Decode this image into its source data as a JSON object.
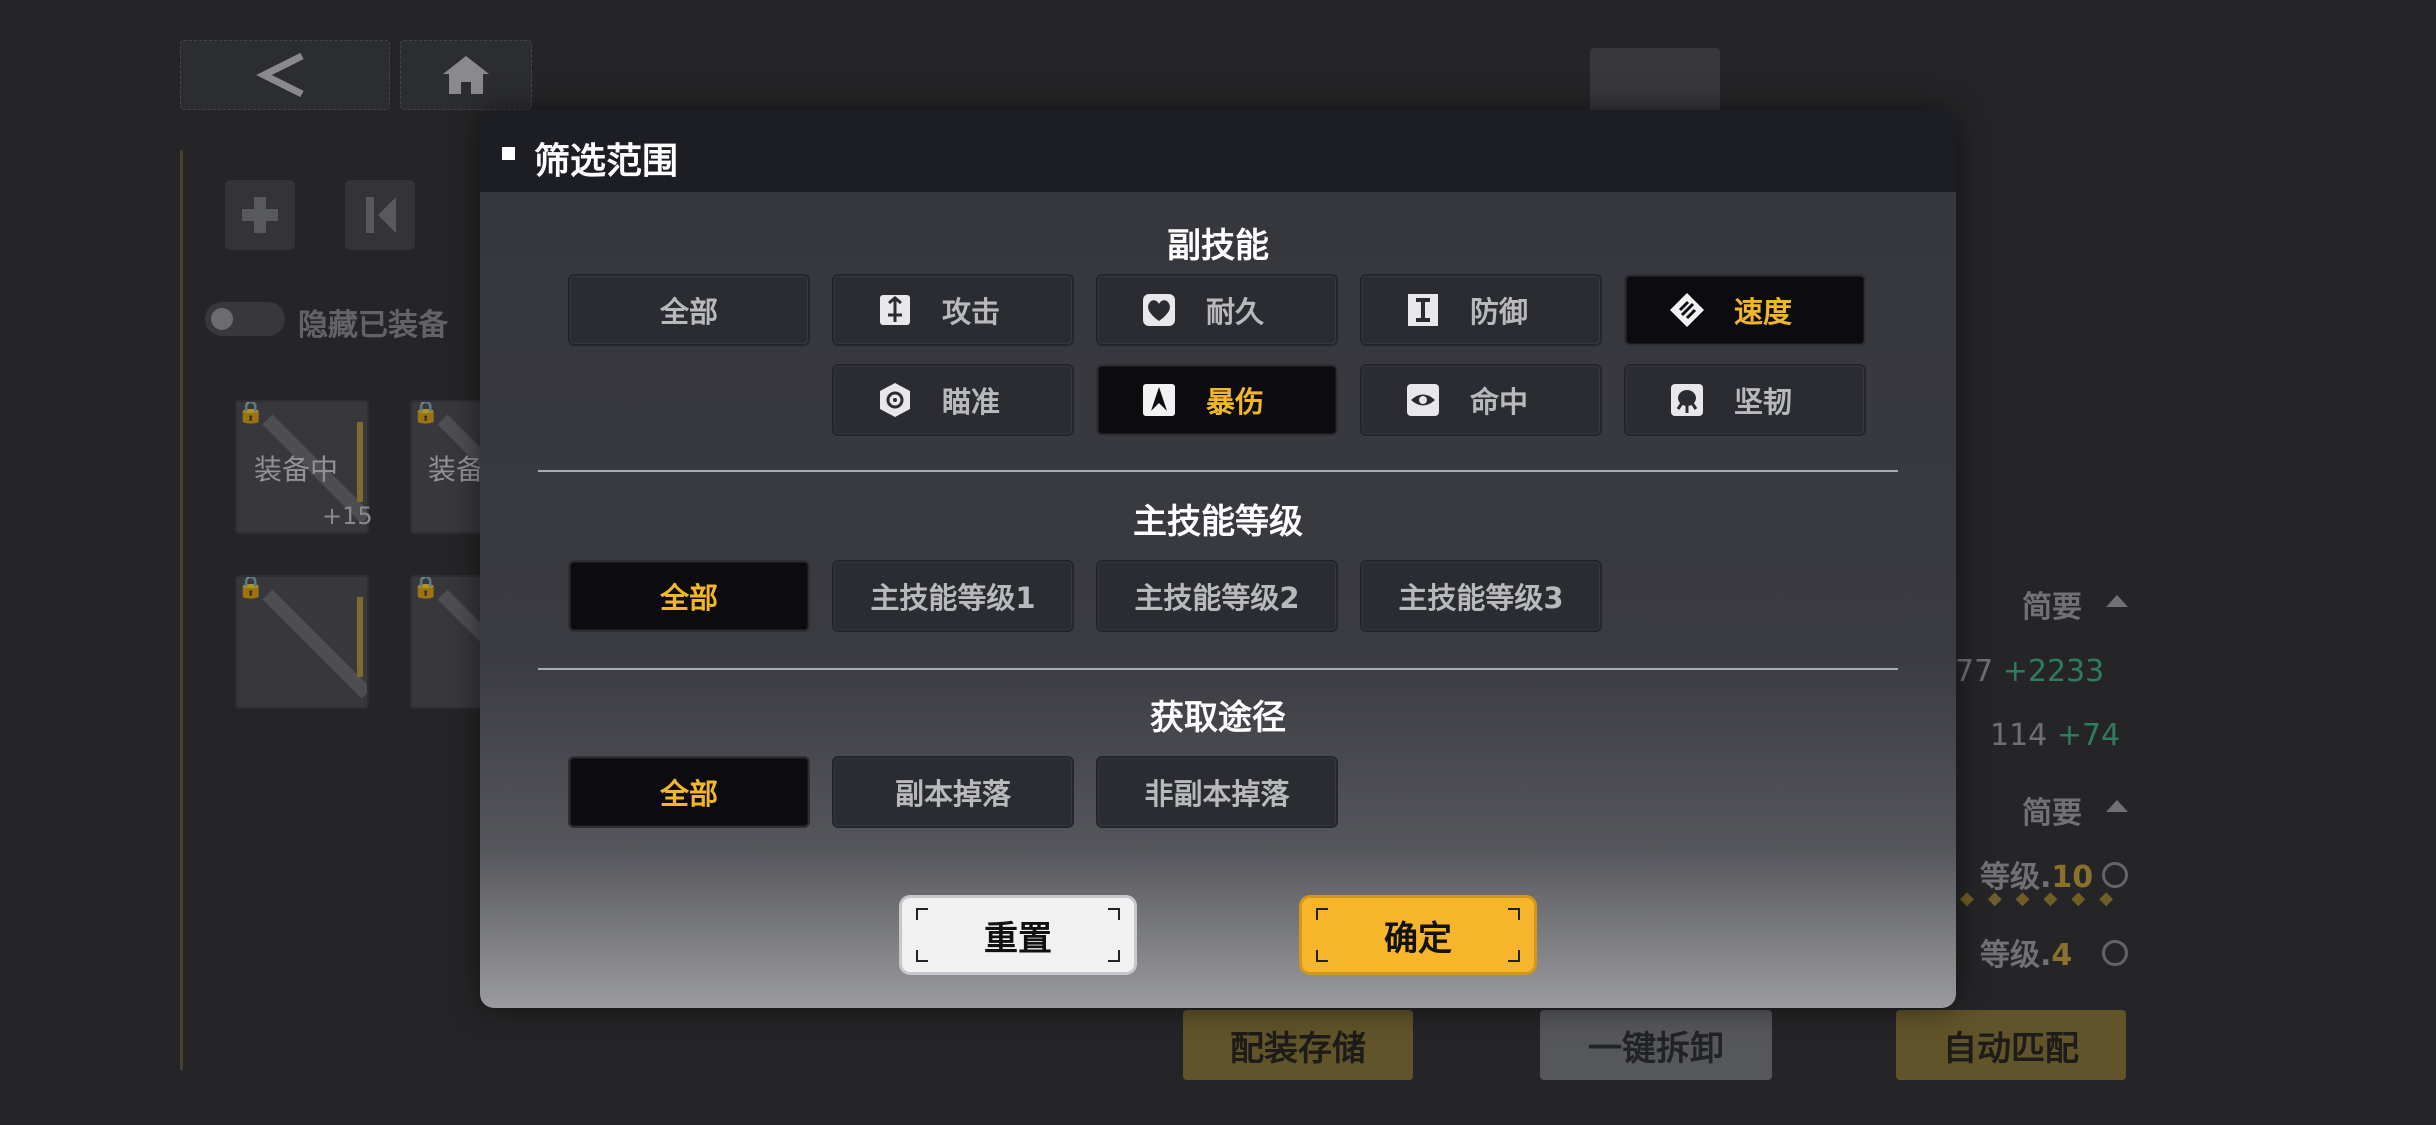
{
  "background": {
    "hide_equipped_label": "隐藏已装备",
    "cards": [
      {
        "label": "装备中",
        "level": "+15"
      },
      {
        "label": "装备"
      }
    ],
    "summary_label": "简要",
    "stats": [
      {
        "base": "77",
        "plus": "+2233"
      },
      {
        "base": "114",
        "plus": "+74"
      }
    ],
    "levels": [
      {
        "label": "等级.",
        "value": "10"
      },
      {
        "label": "等级.",
        "value": "4"
      }
    ],
    "buttons": {
      "loadout_save": "配装存储",
      "one_click_unequip": "一键拆卸",
      "auto_match": "自动匹配"
    }
  },
  "modal": {
    "title": "筛选范围",
    "sections": [
      {
        "title": "副技能",
        "options": [
          {
            "label": "全部",
            "selected": false,
            "icon": ""
          },
          {
            "label": "攻击",
            "selected": false,
            "icon": "attack-icon"
          },
          {
            "label": "耐久",
            "selected": false,
            "icon": "durability-icon"
          },
          {
            "label": "防御",
            "selected": false,
            "icon": "defense-icon"
          },
          {
            "label": "速度",
            "selected": true,
            "icon": "speed-icon"
          },
          {
            "label": "瞄准",
            "selected": false,
            "icon": "aim-icon"
          },
          {
            "label": "暴伤",
            "selected": true,
            "icon": "crit-damage-icon"
          },
          {
            "label": "命中",
            "selected": false,
            "icon": "accuracy-icon"
          },
          {
            "label": "坚韧",
            "selected": false,
            "icon": "tenacity-icon"
          }
        ]
      },
      {
        "title": "主技能等级",
        "options": [
          {
            "label": "全部",
            "selected": true
          },
          {
            "label": "主技能等级1",
            "selected": false
          },
          {
            "label": "主技能等级2",
            "selected": false
          },
          {
            "label": "主技能等级3",
            "selected": false
          }
        ]
      },
      {
        "title": "获取途径",
        "options": [
          {
            "label": "全部",
            "selected": true
          },
          {
            "label": "副本掉落",
            "selected": false
          },
          {
            "label": "非副本掉落",
            "selected": false
          }
        ]
      }
    ],
    "reset_label": "重置",
    "confirm_label": "确定"
  },
  "colors": {
    "accent": "#f6b52b",
    "selected_bg": "#0c0c10",
    "stat_plus": "#3fb18b"
  }
}
